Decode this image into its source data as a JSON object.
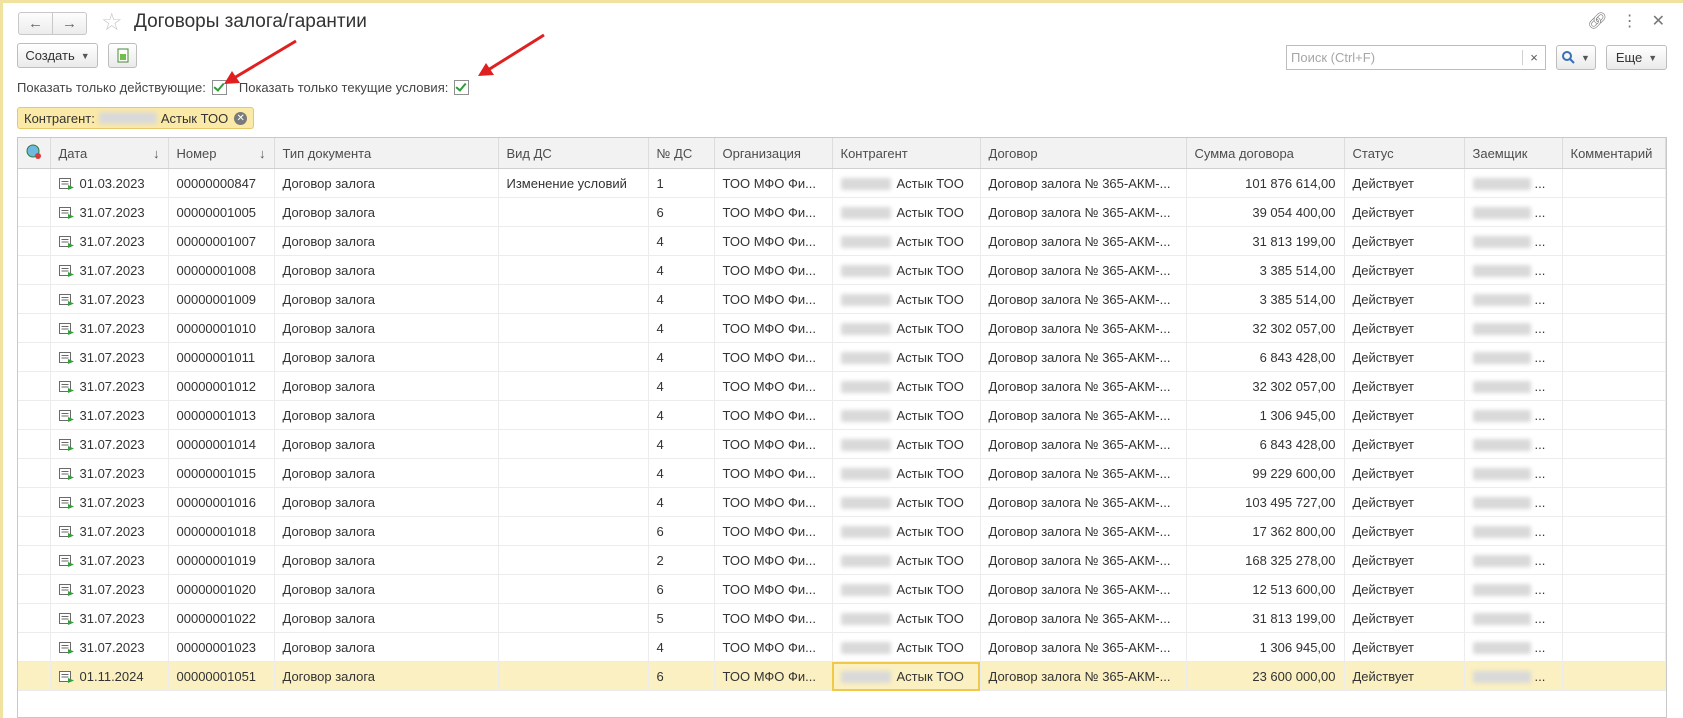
{
  "header": {
    "title": "Договоры залога/гарантии"
  },
  "toolbar": {
    "create_label": "Создать",
    "more_label": "Еще",
    "search_placeholder": "Поиск (Ctrl+F)"
  },
  "filters": {
    "only_active_label": "Показать только действующие:",
    "only_active_checked": true,
    "current_terms_label": "Показать только текущие условия:",
    "current_terms_checked": true
  },
  "tag": {
    "label": "Контрагент:",
    "value": "Астык ТОО"
  },
  "columns": [
    "Дата",
    "Номер",
    "Тип документа",
    "Вид ДС",
    "№ ДС",
    "Организация",
    "Контрагент",
    "Договор",
    "Сумма договора",
    "Статус",
    "Заемщик",
    "Комментарий"
  ],
  "rows": [
    {
      "date": "01.03.2023",
      "number": "00000000847",
      "type": "Договор залога",
      "kind": "Изменение условий",
      "ds": "1",
      "org": "ТОО МФО Фи...",
      "counterparty": "Астык ТОО",
      "contract": "Договор залога № 365-АКМ-...",
      "sum": "101 876 614,00",
      "status": "Действует",
      "borrower": "...",
      "comment": ""
    },
    {
      "date": "31.07.2023",
      "number": "00000001005",
      "type": "Договор залога",
      "kind": "",
      "ds": "6",
      "org": "ТОО МФО Фи...",
      "counterparty": "Астык ТОО",
      "contract": "Договор залога № 365-АКМ-...",
      "sum": "39 054 400,00",
      "status": "Действует",
      "borrower": "...",
      "comment": ""
    },
    {
      "date": "31.07.2023",
      "number": "00000001007",
      "type": "Договор залога",
      "kind": "",
      "ds": "4",
      "org": "ТОО МФО Фи...",
      "counterparty": "Астык ТОО",
      "contract": "Договор залога № 365-АКМ-...",
      "sum": "31 813 199,00",
      "status": "Действует",
      "borrower": "...",
      "comment": ""
    },
    {
      "date": "31.07.2023",
      "number": "00000001008",
      "type": "Договор залога",
      "kind": "",
      "ds": "4",
      "org": "ТОО МФО Фи...",
      "counterparty": "Астык ТОО",
      "contract": "Договор залога № 365-АКМ-...",
      "sum": "3 385 514,00",
      "status": "Действует",
      "borrower": "...",
      "comment": ""
    },
    {
      "date": "31.07.2023",
      "number": "00000001009",
      "type": "Договор залога",
      "kind": "",
      "ds": "4",
      "org": "ТОО МФО Фи...",
      "counterparty": "Астык ТОО",
      "contract": "Договор залога № 365-АКМ-...",
      "sum": "3 385 514,00",
      "status": "Действует",
      "borrower": "...",
      "comment": ""
    },
    {
      "date": "31.07.2023",
      "number": "00000001010",
      "type": "Договор залога",
      "kind": "",
      "ds": "4",
      "org": "ТОО МФО Фи...",
      "counterparty": "Астык ТОО",
      "contract": "Договор залога № 365-АКМ-...",
      "sum": "32 302 057,00",
      "status": "Действует",
      "borrower": "...",
      "comment": ""
    },
    {
      "date": "31.07.2023",
      "number": "00000001011",
      "type": "Договор залога",
      "kind": "",
      "ds": "4",
      "org": "ТОО МФО Фи...",
      "counterparty": "Астык ТОО",
      "contract": "Договор залога № 365-АКМ-...",
      "sum": "6 843 428,00",
      "status": "Действует",
      "borrower": "...",
      "comment": ""
    },
    {
      "date": "31.07.2023",
      "number": "00000001012",
      "type": "Договор залога",
      "kind": "",
      "ds": "4",
      "org": "ТОО МФО Фи...",
      "counterparty": "Астык ТОО",
      "contract": "Договор залога № 365-АКМ-...",
      "sum": "32 302 057,00",
      "status": "Действует",
      "borrower": "...",
      "comment": ""
    },
    {
      "date": "31.07.2023",
      "number": "00000001013",
      "type": "Договор залога",
      "kind": "",
      "ds": "4",
      "org": "ТОО МФО Фи...",
      "counterparty": "Астык ТОО",
      "contract": "Договор залога № 365-АКМ-...",
      "sum": "1 306 945,00",
      "status": "Действует",
      "borrower": "...",
      "comment": ""
    },
    {
      "date": "31.07.2023",
      "number": "00000001014",
      "type": "Договор залога",
      "kind": "",
      "ds": "4",
      "org": "ТОО МФО Фи...",
      "counterparty": "Астык ТОО",
      "contract": "Договор залога № 365-АКМ-...",
      "sum": "6 843 428,00",
      "status": "Действует",
      "borrower": "...",
      "comment": ""
    },
    {
      "date": "31.07.2023",
      "number": "00000001015",
      "type": "Договор залога",
      "kind": "",
      "ds": "4",
      "org": "ТОО МФО Фи...",
      "counterparty": "Астык ТОО",
      "contract": "Договор залога № 365-АКМ-...",
      "sum": "99 229 600,00",
      "status": "Действует",
      "borrower": "...",
      "comment": ""
    },
    {
      "date": "31.07.2023",
      "number": "00000001016",
      "type": "Договор залога",
      "kind": "",
      "ds": "4",
      "org": "ТОО МФО Фи...",
      "counterparty": "Астык ТОО",
      "contract": "Договор залога № 365-АКМ-...",
      "sum": "103 495 727,00",
      "status": "Действует",
      "borrower": "...",
      "comment": ""
    },
    {
      "date": "31.07.2023",
      "number": "00000001018",
      "type": "Договор залога",
      "kind": "",
      "ds": "6",
      "org": "ТОО МФО Фи...",
      "counterparty": "Астык ТОО",
      "contract": "Договор залога № 365-АКМ-...",
      "sum": "17 362 800,00",
      "status": "Действует",
      "borrower": "...",
      "comment": ""
    },
    {
      "date": "31.07.2023",
      "number": "00000001019",
      "type": "Договор залога",
      "kind": "",
      "ds": "2",
      "org": "ТОО МФО Фи...",
      "counterparty": "Астык ТОО",
      "contract": "Договор залога № 365-АКМ-...",
      "sum": "168 325 278,00",
      "status": "Действует",
      "borrower": "...",
      "comment": ""
    },
    {
      "date": "31.07.2023",
      "number": "00000001020",
      "type": "Договор залога",
      "kind": "",
      "ds": "6",
      "org": "ТОО МФО Фи...",
      "counterparty": "Астык ТОО",
      "contract": "Договор залога № 365-АКМ-...",
      "sum": "12 513 600,00",
      "status": "Действует",
      "borrower": "...",
      "comment": ""
    },
    {
      "date": "31.07.2023",
      "number": "00000001022",
      "type": "Договор залога",
      "kind": "",
      "ds": "5",
      "org": "ТОО МФО Фи...",
      "counterparty": "Астык ТОО",
      "contract": "Договор залога № 365-АКМ-...",
      "sum": "31 813 199,00",
      "status": "Действует",
      "borrower": "...",
      "comment": ""
    },
    {
      "date": "31.07.2023",
      "number": "00000001023",
      "type": "Договор залога",
      "kind": "",
      "ds": "4",
      "org": "ТОО МФО Фи...",
      "counterparty": "Астык ТОО",
      "contract": "Договор залога № 365-АКМ-...",
      "sum": "1 306 945,00",
      "status": "Действует",
      "borrower": "...",
      "comment": ""
    },
    {
      "date": "01.11.2024",
      "number": "00000001051",
      "type": "Договор залога",
      "kind": "",
      "ds": "6",
      "org": "ТОО МФО Фи...",
      "counterparty": "Астык ТОО",
      "contract": "Договор залога № 365-АКМ-...",
      "sum": "23 600 000,00",
      "status": "Действует",
      "borrower": "...",
      "comment": "",
      "selected": true
    }
  ]
}
